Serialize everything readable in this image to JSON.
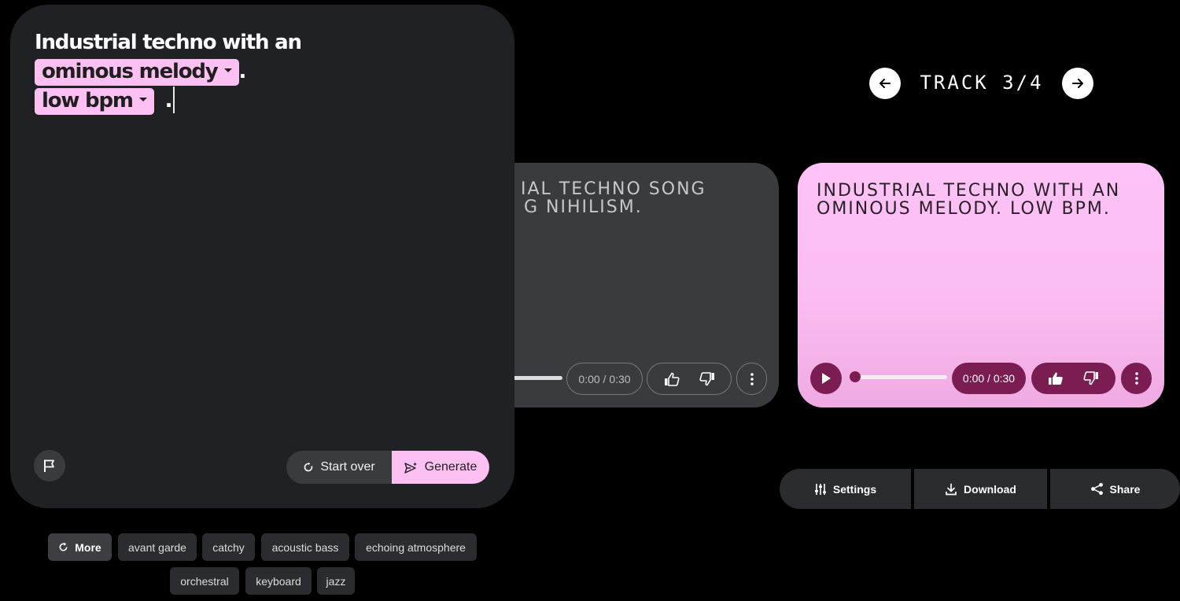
{
  "prompt": {
    "prefix": "Industrial techno with an",
    "chip_1": "ominous melody",
    "period_1": ".",
    "chip_2": "low bpm",
    "period_2": "."
  },
  "actions": {
    "start_over": "Start over",
    "generate": "Generate"
  },
  "suggestions": {
    "more": "More",
    "items": [
      "avant garde",
      "catchy",
      "acoustic bass",
      "echoing atmosphere",
      "orchestral",
      "keyboard",
      "jazz"
    ]
  },
  "track_nav": {
    "label": "TRACK 3/4"
  },
  "previous_track": {
    "title_line_1": "IAL TECHNO SONG",
    "title_line_2": "G NIHILISM.",
    "time": "0:00 / 0:30"
  },
  "current_track": {
    "title": "INDUSTRIAL TECHNO WITH AN OMINOUS MELODY. LOW BPM.",
    "time": "0:00 / 0:30",
    "progress": 0
  },
  "bottom_bar": {
    "settings": "Settings",
    "download": "Download",
    "share": "Share"
  },
  "colors": {
    "accent_pink": "#fcc0f3",
    "player_maroon": "#7b1d52",
    "panel_dark": "#202124"
  }
}
